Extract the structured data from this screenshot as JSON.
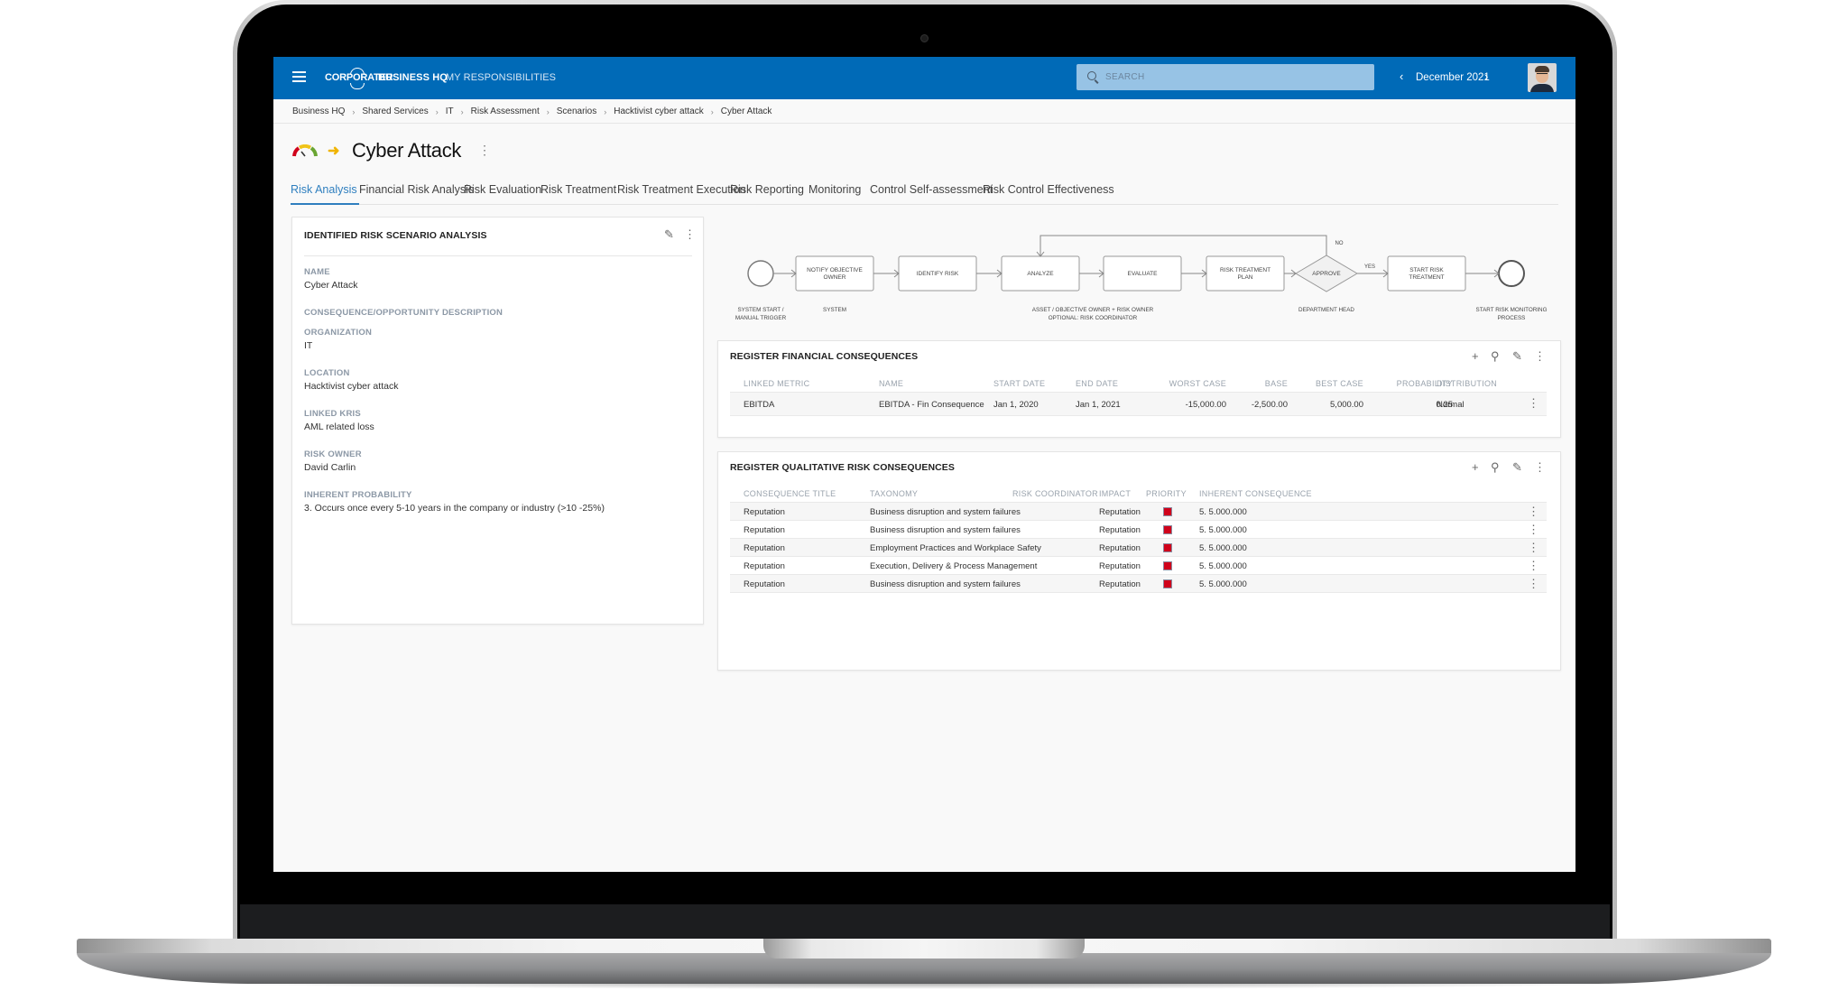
{
  "header": {
    "logo": "CORPORATER",
    "nav": [
      "BUSINESS HQ",
      "MY RESPONSIBILITIES"
    ],
    "search_placeholder": "SEARCH",
    "period": "December 2021",
    "colors": {
      "topbar": "#006ab7",
      "accent": "#2f7fbf",
      "priority_high": "#d0021b"
    }
  },
  "breadcrumb": [
    "Business HQ",
    "Shared Services",
    "IT",
    "Risk Assessment",
    "Scenarios",
    "Hacktivist cyber attack",
    "Cyber Attack"
  ],
  "page": {
    "title": "Cyber Attack",
    "status_icons": [
      "gauge-icon",
      "arrow-right-icon"
    ]
  },
  "tabs": [
    {
      "label": "Risk Analysis",
      "active": true
    },
    {
      "label": "Financial Risk Analysis"
    },
    {
      "label": "Risk Evaluation"
    },
    {
      "label": "Risk Treatment"
    },
    {
      "label": "Risk Treatment Execution"
    },
    {
      "label": "Risk Reporting"
    },
    {
      "label": "Monitoring"
    },
    {
      "label": "Control Self-assessment"
    },
    {
      "label": "Risk Control Effectiveness"
    }
  ],
  "scenario": {
    "title": "IDENTIFIED RISK SCENARIO ANALYSIS",
    "fields": [
      {
        "label": "NAME",
        "value": "Cyber Attack"
      },
      {
        "label": "CONSEQUENCE/OPPORTUNITY DESCRIPTION",
        "value": ""
      },
      {
        "label": "ORGANIZATION",
        "value": "IT"
      },
      {
        "label": "LOCATION",
        "value": "Hacktivist cyber attack"
      },
      {
        "label": "LINKED KRIS",
        "value": "AML related loss"
      },
      {
        "label": "RISK OWNER",
        "value": "David Carlin"
      },
      {
        "label": "INHERENT PROBABILITY",
        "value": "3. Occurs once every 5-10 years in the company or industry (>10 -25%)"
      }
    ]
  },
  "process": {
    "steps": [
      "NOTIFY OBJECTIVE OWNER",
      "IDENTIFY RISK",
      "ANALYZE",
      "EVALUATE",
      "RISK TREATMENT PLAN",
      "APPROVE",
      "START RISK TREATMENT"
    ],
    "labels": {
      "start": [
        "SYSTEM START /",
        "MANUAL TRIGGER"
      ],
      "system": "SYSTEM",
      "owners": [
        "ASSET / OBJECTIVE OWNER + RISK OWNER",
        "OPTIONAL: RISK COORDINATOR"
      ],
      "dept": "DEPARTMENT HEAD",
      "end": [
        "START RISK MONITORING",
        "PROCESS"
      ],
      "yes": "YES",
      "no": "NO"
    }
  },
  "financial": {
    "title": "REGISTER FINANCIAL CONSEQUENCES",
    "columns": [
      "LINKED METRIC",
      "NAME",
      "START DATE",
      "END DATE",
      "WORST CASE",
      "BASE",
      "BEST CASE",
      "PROBABILITY",
      "DISTRIBUTION"
    ],
    "rows": [
      [
        "EBITDA",
        "EBITDA - Fin Consequence",
        "Jan 1, 2020",
        "Jan 1, 2021",
        "-15,000.00",
        "-2,500.00",
        "5,000.00",
        "0.25",
        "Normal"
      ]
    ]
  },
  "qualitative": {
    "title": "REGISTER QUALITATIVE RISK CONSEQUENCES",
    "columns": [
      "CONSEQUENCE TITLE",
      "TAXONOMY",
      "RISK COORDINATOR",
      "IMPACT",
      "PRIORITY",
      "INHERENT CONSEQUENCE"
    ],
    "rows": [
      [
        "Reputation",
        "Business disruption and system failures",
        "",
        "Reputation",
        "high",
        "5. 5.000.000"
      ],
      [
        "Reputation",
        "Business disruption and system failures",
        "",
        "Reputation",
        "high",
        "5. 5.000.000"
      ],
      [
        "Reputation",
        "Employment Practices and Workplace Safety",
        "",
        "Reputation",
        "high",
        "5. 5.000.000"
      ],
      [
        "Reputation",
        "Execution, Delivery & Process Management",
        "",
        "Reputation",
        "high",
        "5. 5.000.000"
      ],
      [
        "Reputation",
        "Business disruption and system failures",
        "",
        "Reputation",
        "high",
        "5. 5.000.000"
      ]
    ]
  }
}
